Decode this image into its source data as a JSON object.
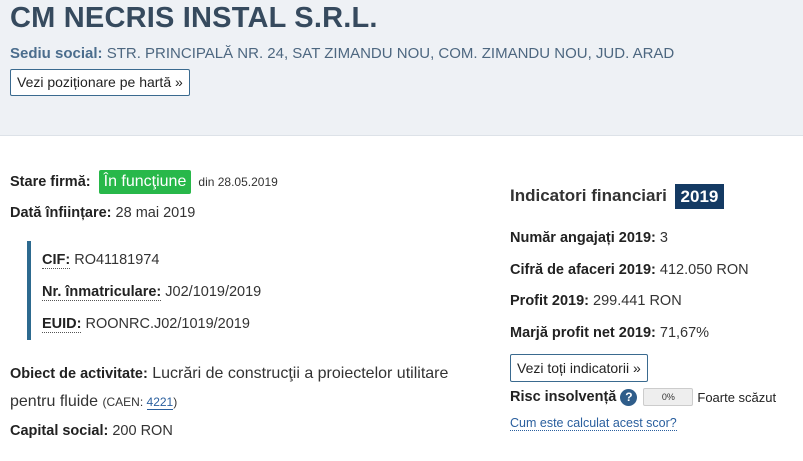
{
  "company": {
    "name": "CM NECRIS INSTAL S.R.L.",
    "hq_label": "Sediu social:",
    "hq_value": "STR. PRINCIPALĂ NR. 24, SAT ZIMANDU NOU, COM. ZIMANDU NOU, JUD. ARAD",
    "map_button": "Vezi poziționare pe hartă »"
  },
  "status": {
    "label": "Stare firmă:",
    "badge": "În funcţiune",
    "since": "din 28.05.2019",
    "badge_color": "#28b84a"
  },
  "founded": {
    "label": "Dată înființare:",
    "value": "28 mai 2019"
  },
  "ids": {
    "cif_label": "CIF:",
    "cif_value": "RO41181974",
    "reg_label": "Nr. înmatriculare:",
    "reg_value": "J02/1019/2019",
    "euid_label": "EUID:",
    "euid_value": "ROONRC.J02/1019/2019",
    "accent_color": "#2d6a8f"
  },
  "activity": {
    "label": "Obiect de activitate:",
    "value": "Lucrări de construcţii a proiectelor utilitare pentru fluide",
    "caen_prefix": "(CAEN: ",
    "caen_code": "4221",
    "caen_suffix": ")"
  },
  "capital": {
    "label": "Capital social:",
    "value": "200 RON"
  },
  "financials": {
    "title": "Indicatori financiari",
    "year": "2019",
    "year_badge_color": "#143a63",
    "employees_label": "Număr angajați 2019:",
    "employees_value": "3",
    "turnover_label": "Cifră de afaceri 2019:",
    "turnover_value": "412.050 RON",
    "profit_label": "Profit 2019:",
    "profit_value": "299.441 RON",
    "margin_label": "Marjă profit net 2019:",
    "margin_value": "71,67%",
    "all_button": "Vezi toți indicatorii »"
  },
  "risk": {
    "label": "Risc insolvență",
    "help_icon": "question-circle-icon",
    "help_glyph": "?",
    "percent_text": "0%",
    "percent_value": 0,
    "description": "Foarte scăzut",
    "score_link": "Cum este calculat acest scor?"
  }
}
